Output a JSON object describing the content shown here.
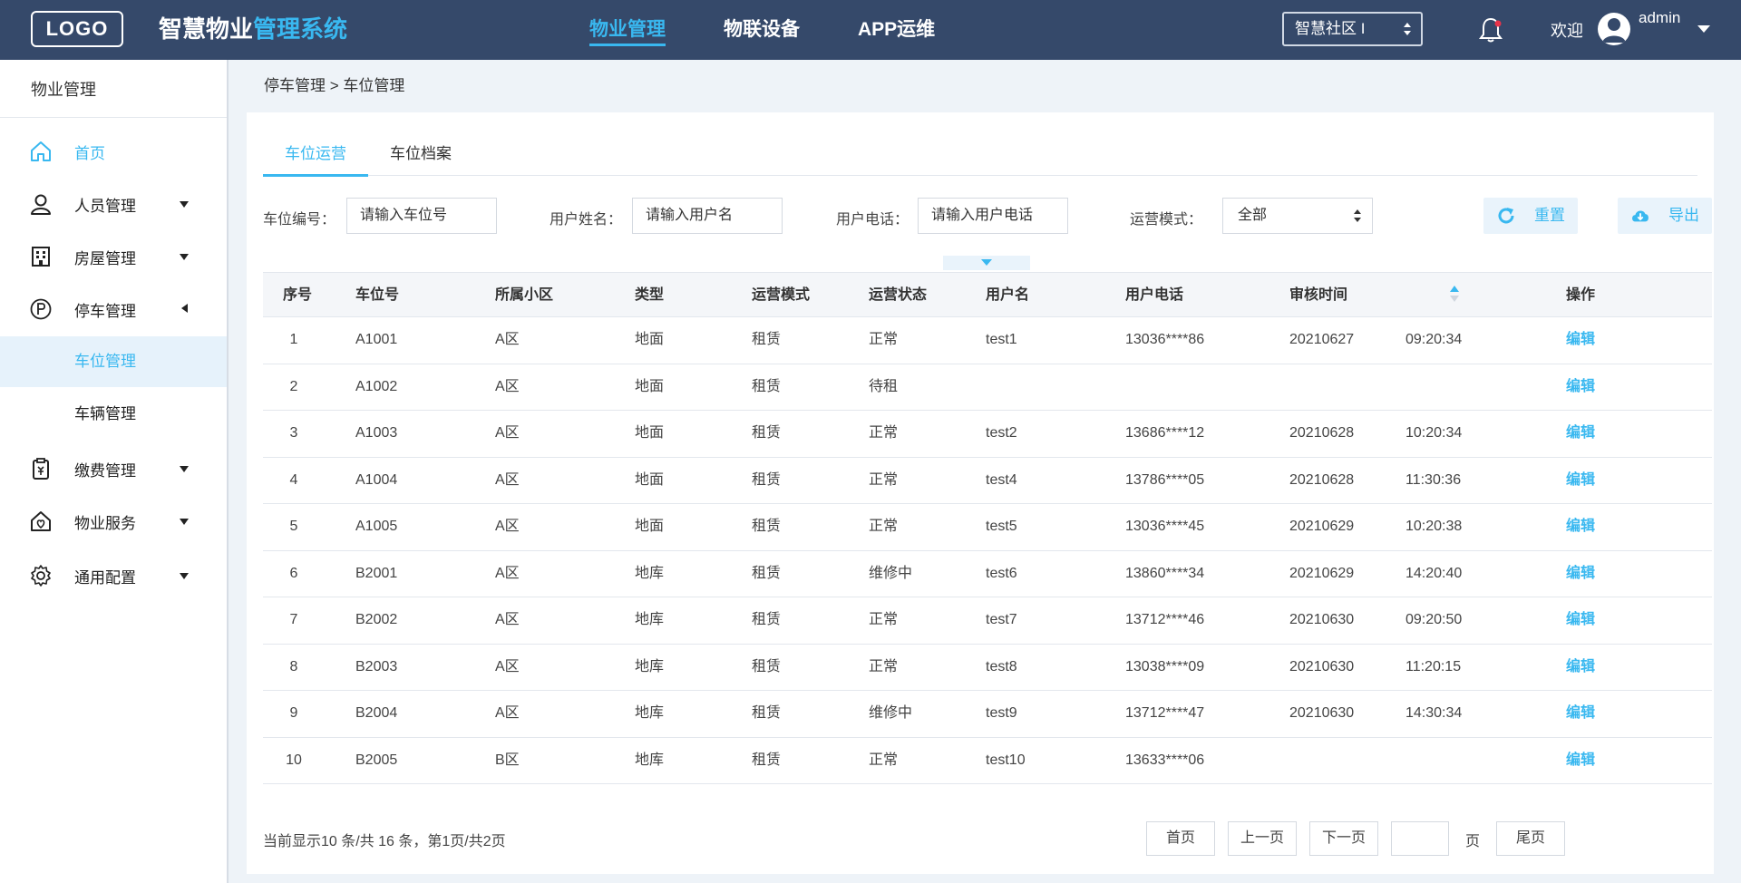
{
  "header": {
    "logo": "LOGO",
    "title_part1": "智慧物业",
    "title_part2": "管理系统",
    "nav": [
      {
        "label": "物业管理",
        "active": true
      },
      {
        "label": "物联设备",
        "active": false
      },
      {
        "label": "APP运维",
        "active": false
      }
    ],
    "community_select": "智慧社区 I",
    "welcome": "欢迎",
    "username": "admin"
  },
  "sidebar": {
    "title": "物业管理",
    "items": [
      {
        "label": "首页",
        "icon": "home-icon"
      },
      {
        "label": "人员管理",
        "icon": "user-icon"
      },
      {
        "label": "房屋管理",
        "icon": "building-icon"
      },
      {
        "label": "停车管理",
        "icon": "parking-icon"
      },
      {
        "label": "车位管理"
      },
      {
        "label": "车辆管理"
      },
      {
        "label": "缴费管理",
        "icon": "payment-icon"
      },
      {
        "label": "物业服务",
        "icon": "service-icon"
      },
      {
        "label": "通用配置",
        "icon": "settings-icon"
      }
    ]
  },
  "breadcrumb": "停车管理 > 车位管理",
  "tabs": [
    {
      "label": "车位运营",
      "active": true
    },
    {
      "label": "车位档案",
      "active": false
    }
  ],
  "filters": {
    "space_label": "车位编号：",
    "space_placeholder": "请输入车位号",
    "name_label": "用户姓名：",
    "name_placeholder": "请输入用户名",
    "phone_label": "用户电话：",
    "phone_placeholder": "请输入用户电话",
    "mode_label": "运营模式：",
    "mode_value": "全部",
    "reset_label": "重置",
    "export_label": "导出"
  },
  "table": {
    "headers": [
      "序号",
      "车位号",
      "所属小区",
      "类型",
      "运营模式",
      "运营状态",
      "用户名",
      "用户电话",
      "审核时间",
      "操作"
    ],
    "rows": [
      [
        "1",
        "A1001",
        "A区",
        "地面",
        "租赁",
        "正常",
        "test1",
        "13036****86",
        "20210627",
        "09:20:34",
        "编辑"
      ],
      [
        "2",
        "A1002",
        "A区",
        "地面",
        "租赁",
        "待租",
        "",
        "",
        "",
        "",
        "编辑"
      ],
      [
        "3",
        "A1003",
        "A区",
        "地面",
        "租赁",
        "正常",
        "test2",
        "13686****12",
        "20210628",
        "10:20:34",
        "编辑"
      ],
      [
        "4",
        "A1004",
        "A区",
        "地面",
        "租赁",
        "正常",
        "test4",
        "13786****05",
        "20210628",
        "11:30:36",
        "编辑"
      ],
      [
        "5",
        "A1005",
        "A区",
        "地面",
        "租赁",
        "正常",
        "test5",
        "13036****45",
        "20210629",
        "10:20:38",
        "编辑"
      ],
      [
        "6",
        "B2001",
        "A区",
        "地库",
        "租赁",
        "维修中",
        "test6",
        "13860****34",
        "20210629",
        "14:20:40",
        "编辑"
      ],
      [
        "7",
        "B2002",
        "A区",
        "地库",
        "租赁",
        "正常",
        "test7",
        "13712****46",
        "20210630",
        "09:20:50",
        "编辑"
      ],
      [
        "8",
        "B2003",
        "A区",
        "地库",
        "租赁",
        "正常",
        "test8",
        "13038****09",
        "20210630",
        "11:20:15",
        "编辑"
      ],
      [
        "9",
        "B2004",
        "A区",
        "地库",
        "租赁",
        "维修中",
        "test9",
        "13712****47",
        "20210630",
        "14:30:34",
        "编辑"
      ],
      [
        "10",
        "B2005",
        "B区",
        "地库",
        "租赁",
        "正常",
        "test10",
        "13633****06",
        "",
        "",
        "编辑"
      ]
    ]
  },
  "pagination": {
    "info": "当前显示10 条/共 16 条，第1页/共2页",
    "first": "首页",
    "prev": "上一页",
    "next": "下一页",
    "page_unit": "页",
    "last": "尾页"
  },
  "colors": {
    "header_bg": "#35496a",
    "accent": "#39b8f0",
    "page_bg": "#eef3f8"
  }
}
